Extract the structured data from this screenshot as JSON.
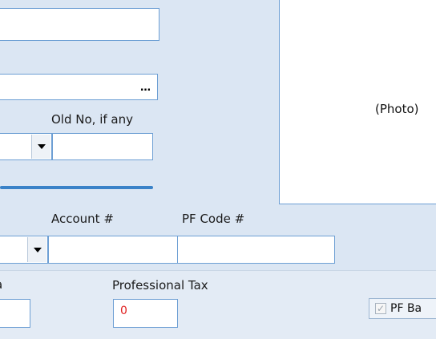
{
  "photo": {
    "label": "(Photo)"
  },
  "labels": {
    "old_no": "Old No, if any",
    "account_no": "Account #",
    "pf_code": "PF Code #",
    "professional_tax": "Professional Tax",
    "clipped_left": "a"
  },
  "fields": {
    "professional_tax_value": "0"
  },
  "buttons": {
    "ellipsis": "…"
  },
  "checkbox": {
    "label": "PF Ba",
    "checked": true
  },
  "colors": {
    "background": "#dbe6f3",
    "field_border": "#6d9fd4",
    "separator": "#3a82c8",
    "value_red": "#e02020"
  }
}
